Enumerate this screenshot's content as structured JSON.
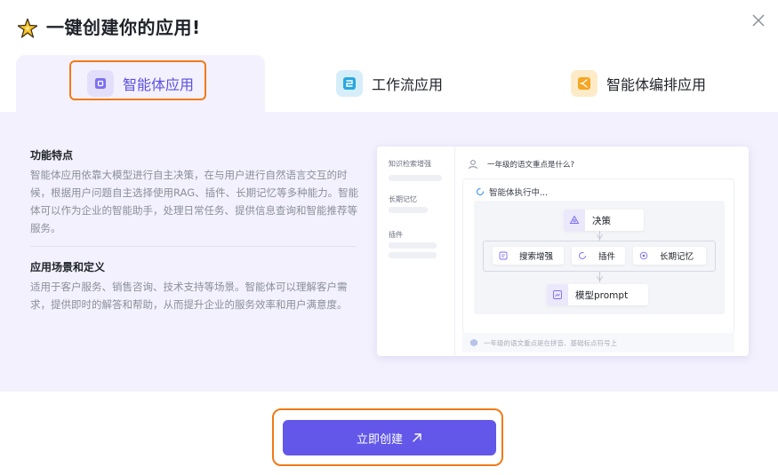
{
  "dialog": {
    "title": "一键创建你的应用!"
  },
  "tabs": [
    {
      "label": "智能体应用",
      "active": true,
      "icon": "agent-app-icon",
      "color": "#7b6ff0"
    },
    {
      "label": "工作流应用",
      "active": false,
      "icon": "workflow-icon",
      "color": "#2aa7e0"
    },
    {
      "label": "智能体编排应用",
      "active": false,
      "icon": "agent-orchestration-icon",
      "color": "#f5a623"
    }
  ],
  "features": {
    "title": "功能特点",
    "text": "智能体应用依靠大模型进行自主决策，在与用户进行自然语言交互的时候，根据用户问题自主选择使用RAG、插件、长期记忆等多种能力。智能体可以作为企业的智能助手，处理日常任务、提供信息查询和智能推荐等服务。"
  },
  "scenarios": {
    "title": "应用场景和定义",
    "text": "适用于客户服务、销售咨询、技术支持等场景。智能体可以理解客户需求，提供即时的解答和帮助，从而提升企业的服务效率和用户满意度。"
  },
  "preview": {
    "sidebar": [
      "知识检索增强",
      "长期记忆",
      "插件"
    ],
    "question": "一年级的语文重点是什么?",
    "status": "智能体执行中...",
    "nodes": {
      "decision": "决策",
      "search": "搜索增强",
      "plugin": "插件",
      "memory": "长期记忆",
      "model": "模型prompt"
    },
    "answer_preview": "一年级的语文重点是在拼音、基础标点符号上"
  },
  "footer": {
    "create_label": "立即创建"
  },
  "colors": {
    "accent": "#6257e8",
    "highlight": "#f07a16",
    "panel_bg": "#f3f1fd"
  }
}
